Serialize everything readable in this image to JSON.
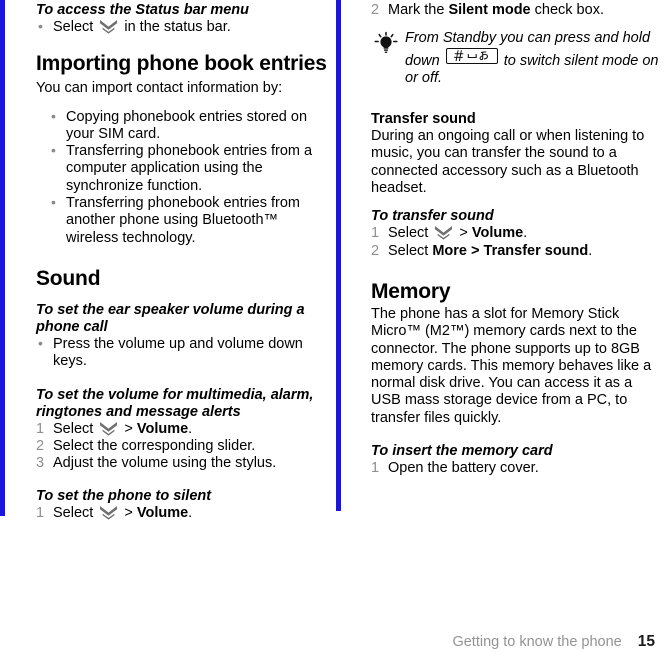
{
  "document": {
    "footer": {
      "section_label": "Getting to know the phone",
      "page_number": "15"
    },
    "accent_color": "#1a16e0",
    "bullet_color": "#8a8a8a",
    "step_number_color": "#8f8f8f",
    "footer_section_color": "#939393"
  },
  "left_column": {
    "proc_status_bar": {
      "heading": "To access the Status bar menu",
      "bullets": [
        {
          "pre": "Select ",
          "icon": "chevron-double-down-icon",
          "post": " in the status bar."
        }
      ]
    },
    "importing": {
      "heading": "Importing phone book entries",
      "intro": "You can import contact information by:",
      "bullets": [
        {
          "text": "Copying phonebook entries stored on your SIM card."
        },
        {
          "text": "Transferring phonebook entries from a computer application using the synchronize function."
        },
        {
          "text": "Transferring phonebook entries from another phone using Bluetooth™ wireless technology."
        }
      ]
    },
    "sound": {
      "heading": "Sound",
      "proc_ear_speaker": {
        "heading": "To set the ear speaker volume during a phone call",
        "bullets": [
          {
            "text": "Press the volume up and volume down keys."
          }
        ]
      },
      "proc_multimedia_volume": {
        "heading": "To set the volume for multimedia, alarm, ringtones and message alerts",
        "steps": [
          {
            "pre": "Select ",
            "icon": "chevron-double-down-icon",
            "post": " > ",
            "bold": "Volume",
            "tail": "."
          },
          {
            "pre": "Select the corresponding slider."
          },
          {
            "pre": "Adjust the volume using the stylus."
          }
        ]
      },
      "proc_silent": {
        "heading": "To set the phone to silent",
        "steps": [
          {
            "pre": "Select ",
            "icon": "chevron-double-down-icon",
            "post": " > ",
            "bold": "Volume",
            "tail": "."
          }
        ]
      }
    }
  },
  "right_column": {
    "proc_silent_cont": {
      "steps": [
        {
          "pre": "Mark the ",
          "bold": "Silent mode",
          "tail": " check box."
        }
      ],
      "start_number": 2
    },
    "tip": {
      "icon": "lightbulb-tip-icon",
      "text_before_key": "From Standby you can press and hold down ",
      "key_label": "#",
      "key_icon": "hash-space-key-icon",
      "text_after_key": " to switch silent mode on or off."
    },
    "transfer_sound": {
      "heading": "Transfer sound",
      "body": "During an ongoing call or when listening to music, you can transfer the sound to a connected accessory such as a Bluetooth headset.",
      "proc": {
        "heading": "To transfer sound",
        "steps": [
          {
            "pre": "Select ",
            "icon": "chevron-double-down-icon",
            "post": " > ",
            "bold": "Volume",
            "tail": "."
          },
          {
            "pre": "Select ",
            "bold": "More > Transfer sound",
            "tail": "."
          }
        ]
      }
    },
    "memory": {
      "heading": "Memory",
      "body": "The phone has a slot for Memory Stick Micro™ (M2™) memory cards next to the connector. The phone supports up to 8GB memory cards. This memory behaves like a normal disk drive. You can access it as a USB mass storage device from a PC, to transfer files quickly.",
      "proc": {
        "heading": "To insert the memory card",
        "steps": [
          {
            "pre": "Open the battery cover."
          }
        ]
      }
    }
  }
}
